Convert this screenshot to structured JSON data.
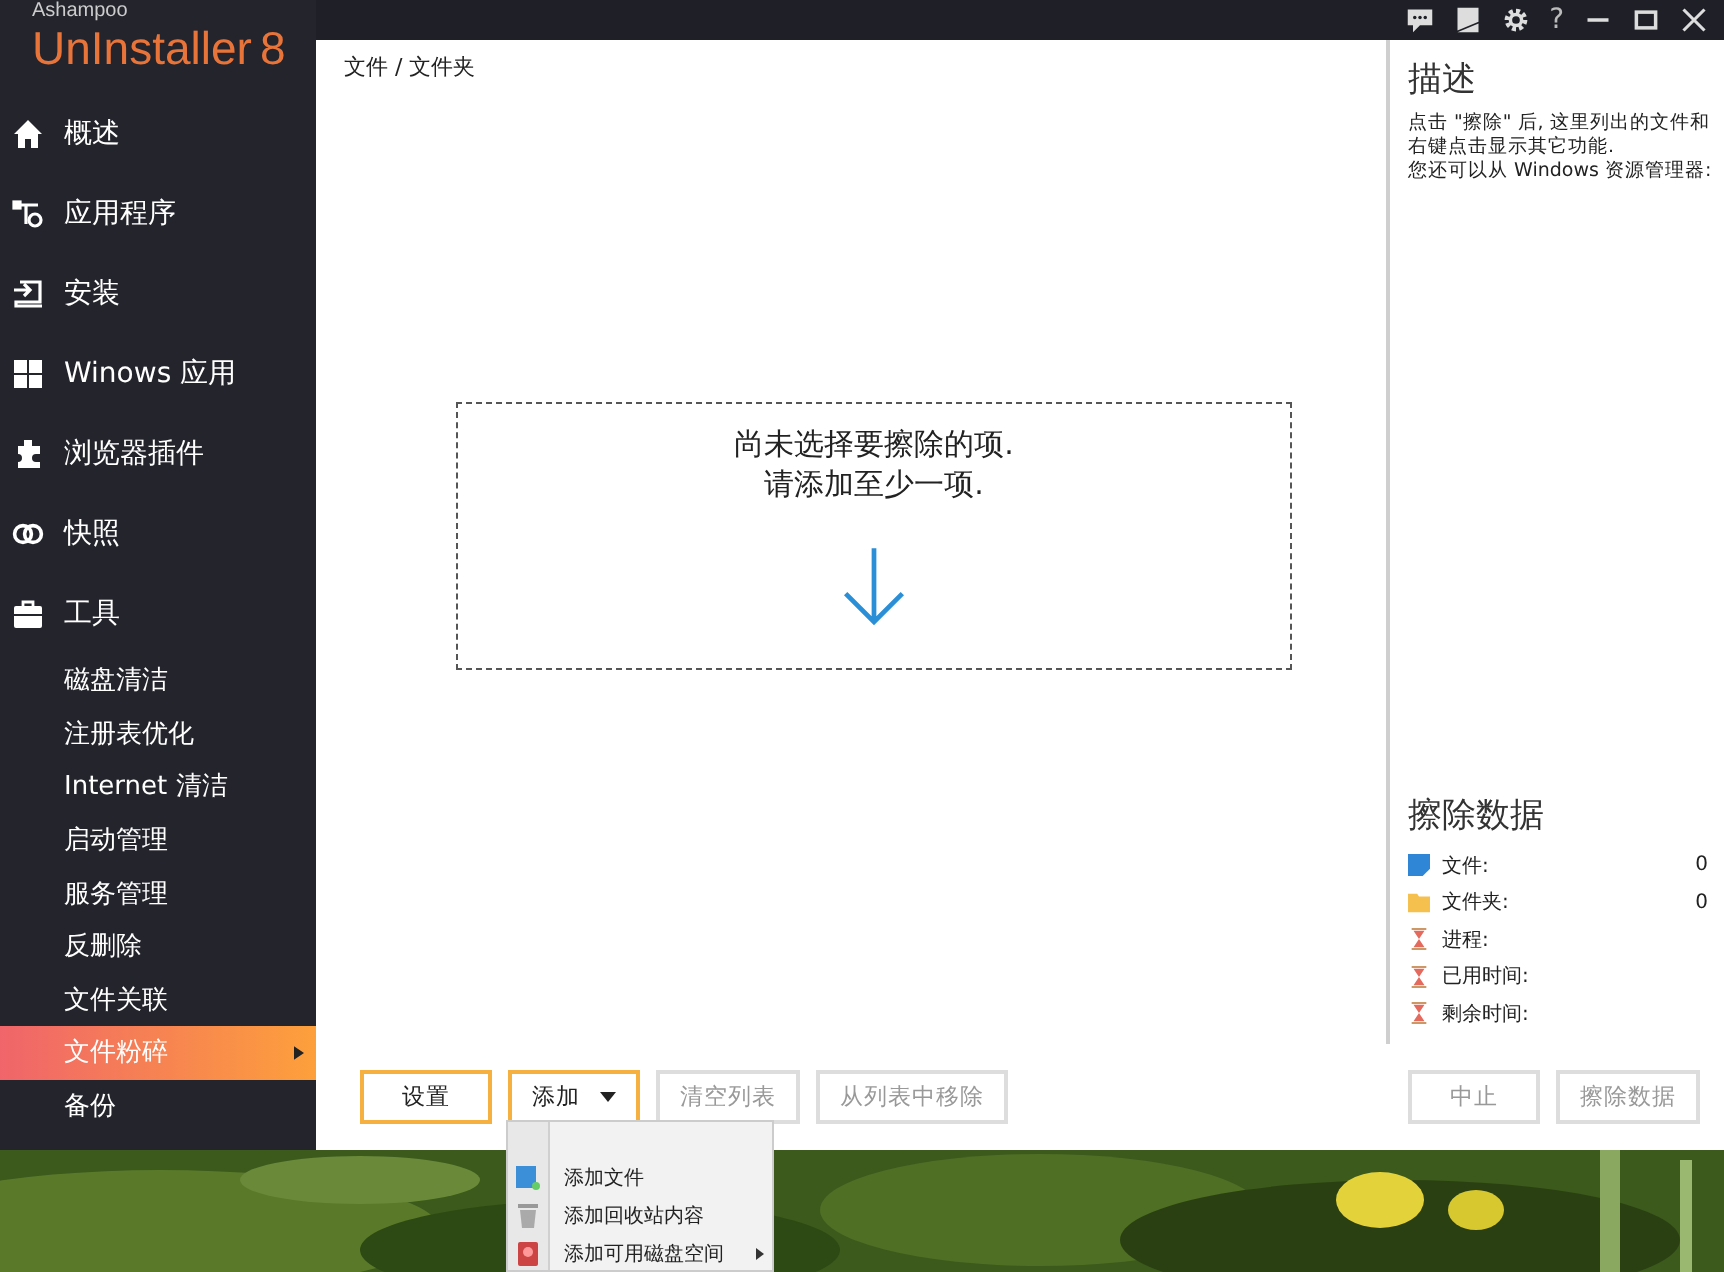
{
  "logo": {
    "brand": "Ashampoo",
    "product": "UnInstaller",
    "version": "8"
  },
  "title_bar": {
    "help": "?"
  },
  "sidebar": {
    "items": [
      {
        "label": "概述",
        "selected": false
      },
      {
        "label": "应用程序",
        "selected": false
      },
      {
        "label": "安装",
        "selected": false
      },
      {
        "label": "Winows 应用",
        "selected": false
      },
      {
        "label": "浏览器插件",
        "selected": false
      },
      {
        "label": "快照",
        "selected": false
      },
      {
        "label": "工具",
        "selected": false,
        "children": [
          {
            "label": "磁盘清洁",
            "selected": false
          },
          {
            "label": "注册表优化",
            "selected": false
          },
          {
            "label": "Internet 清洁",
            "selected": false
          },
          {
            "label": "启动管理",
            "selected": false
          },
          {
            "label": "服务管理",
            "selected": false
          },
          {
            "label": "反删除",
            "selected": false
          },
          {
            "label": "文件关联",
            "selected": false
          },
          {
            "label": "文件粉碎",
            "selected": true
          },
          {
            "label": "备份",
            "selected": false
          }
        ]
      }
    ]
  },
  "breadcrumb": "文件 / 文件夹",
  "empty_state": {
    "lines": [
      "尚未选择要擦除的项.",
      "请添加至少一项."
    ]
  },
  "description": {
    "title": "描述",
    "lines": [
      "点击 \"擦除\" 后, 这里列出的文件和",
      "右键点击显示其它功能.",
      "您还可以从 Windows 资源管理器:"
    ]
  },
  "erase_data": {
    "title": "擦除数据",
    "rows": [
      {
        "kind": "file",
        "label": "文件:",
        "value": "0"
      },
      {
        "kind": "folder",
        "label": "文件夹:",
        "value": "0"
      },
      {
        "kind": "timer",
        "label": "进程:"
      },
      {
        "kind": "timer",
        "label": "已用时间:"
      },
      {
        "kind": "timer",
        "label": "剩余时间:"
      }
    ]
  },
  "toolbar": {
    "left": [
      {
        "label": "设置",
        "disabled": false,
        "dropdown": false
      },
      {
        "label": "添加",
        "disabled": false,
        "dropdown": true
      },
      {
        "label": "清空列表",
        "disabled": true,
        "dropdown": false
      },
      {
        "label": "从列表中移除",
        "disabled": true,
        "dropdown": false
      }
    ],
    "right": [
      {
        "label": "中止",
        "disabled": true,
        "dropdown": false
      },
      {
        "label": "擦除数据",
        "disabled": true,
        "dropdown": false
      }
    ]
  },
  "add_menu": {
    "items": [
      {
        "kind": "file",
        "label": "添加文件",
        "submenu": false
      },
      {
        "kind": "bin",
        "label": "添加回收站内容",
        "submenu": false
      },
      {
        "kind": "disk",
        "label": "添加可用磁盘空间",
        "submenu": true
      }
    ]
  }
}
